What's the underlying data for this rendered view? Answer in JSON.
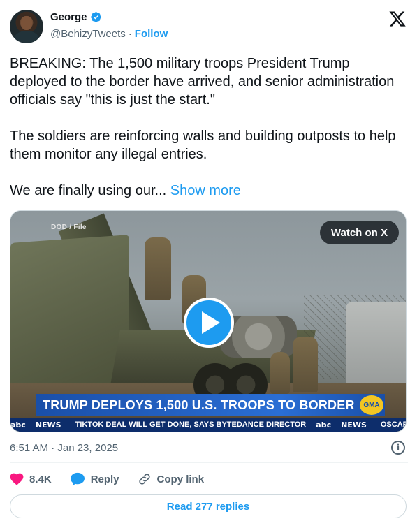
{
  "author": {
    "display_name": "George",
    "handle": "@BehizyTweets",
    "separator": "·",
    "follow_label": "Follow"
  },
  "tweet": {
    "paragraphs": [
      "BREAKING: The 1,500 military troops President Trump deployed to the border have arrived, and senior administration officials say \"this is just the start.\"",
      "The soldiers are reinforcing walls and building outposts to help them monitor any illegal entries.",
      "We are finally using our..."
    ],
    "show_more_label": "Show more"
  },
  "media": {
    "source_label": "DOD / File",
    "watch_label": "Watch on X",
    "headline": "TRUMP DEPLOYS 1,500 U.S. TROOPS TO BORDER",
    "gma_badge": "GMA",
    "ticker_brand": "abc",
    "ticker_news": "NEWS",
    "ticker_items": [
      "TIKTOK DEAL WILL GET DONE, SAYS BYTEDANCE DIRECTOR",
      "OSCAR NOMINATIONS O"
    ]
  },
  "meta": {
    "timestamp": "6:51 AM · Jan 23, 2025"
  },
  "actions": {
    "like_count": "8.4K",
    "reply_label": "Reply",
    "copy_link_label": "Copy link"
  },
  "footer": {
    "read_replies_label": "Read 277 replies"
  },
  "colors": {
    "accent": "#1d9bf0",
    "like": "#f91880",
    "text": "#0f1419",
    "muted": "#536471"
  }
}
